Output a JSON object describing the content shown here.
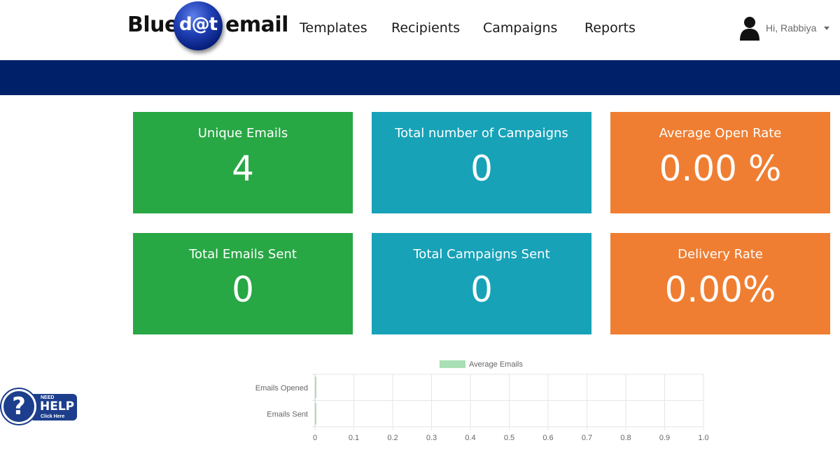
{
  "header": {
    "logo": {
      "left": "Blue",
      "middle": "d@t",
      "right": "email"
    },
    "nav": [
      {
        "label": "Templates"
      },
      {
        "label": "Recipients"
      },
      {
        "label": "Campaigns"
      },
      {
        "label": "Reports"
      }
    ],
    "user": {
      "greeting": "Hi, Rabbiya",
      "icon": "user-icon"
    }
  },
  "stats": [
    {
      "title": "Unique Emails",
      "value": "4",
      "color": "#28a745"
    },
    {
      "title": "Total number of Campaigns",
      "value": "0",
      "color": "#17a2b8"
    },
    {
      "title": "Average Open Rate",
      "value": "0.00 %",
      "color": "#ef7e32"
    },
    {
      "title": "Total Emails Sent",
      "value": "0",
      "color": "#28a745"
    },
    {
      "title": "Total Campaigns Sent",
      "value": "0",
      "color": "#17a2b8"
    },
    {
      "title": "Delivery Rate",
      "value": "0.00%",
      "color": "#ef7e32"
    }
  ],
  "colors": {
    "banner": "#002069",
    "series": "#a8dfb4"
  },
  "help": {
    "need": "NEED",
    "help": "HELP",
    "click": "Click Here",
    "icon": "question-mark-icon"
  },
  "chart_data": {
    "type": "bar",
    "orientation": "horizontal",
    "categories": [
      "Emails Opened",
      "Emails Sent"
    ],
    "series": [
      {
        "name": "Average Emails",
        "values": [
          0,
          0
        ]
      }
    ],
    "xlim": [
      0,
      1.0
    ],
    "xticks": [
      "0",
      "0.1",
      "0.2",
      "0.3",
      "0.4",
      "0.5",
      "0.6",
      "0.7",
      "0.8",
      "0.9",
      "1.0"
    ],
    "legend": "top",
    "grid": true
  }
}
